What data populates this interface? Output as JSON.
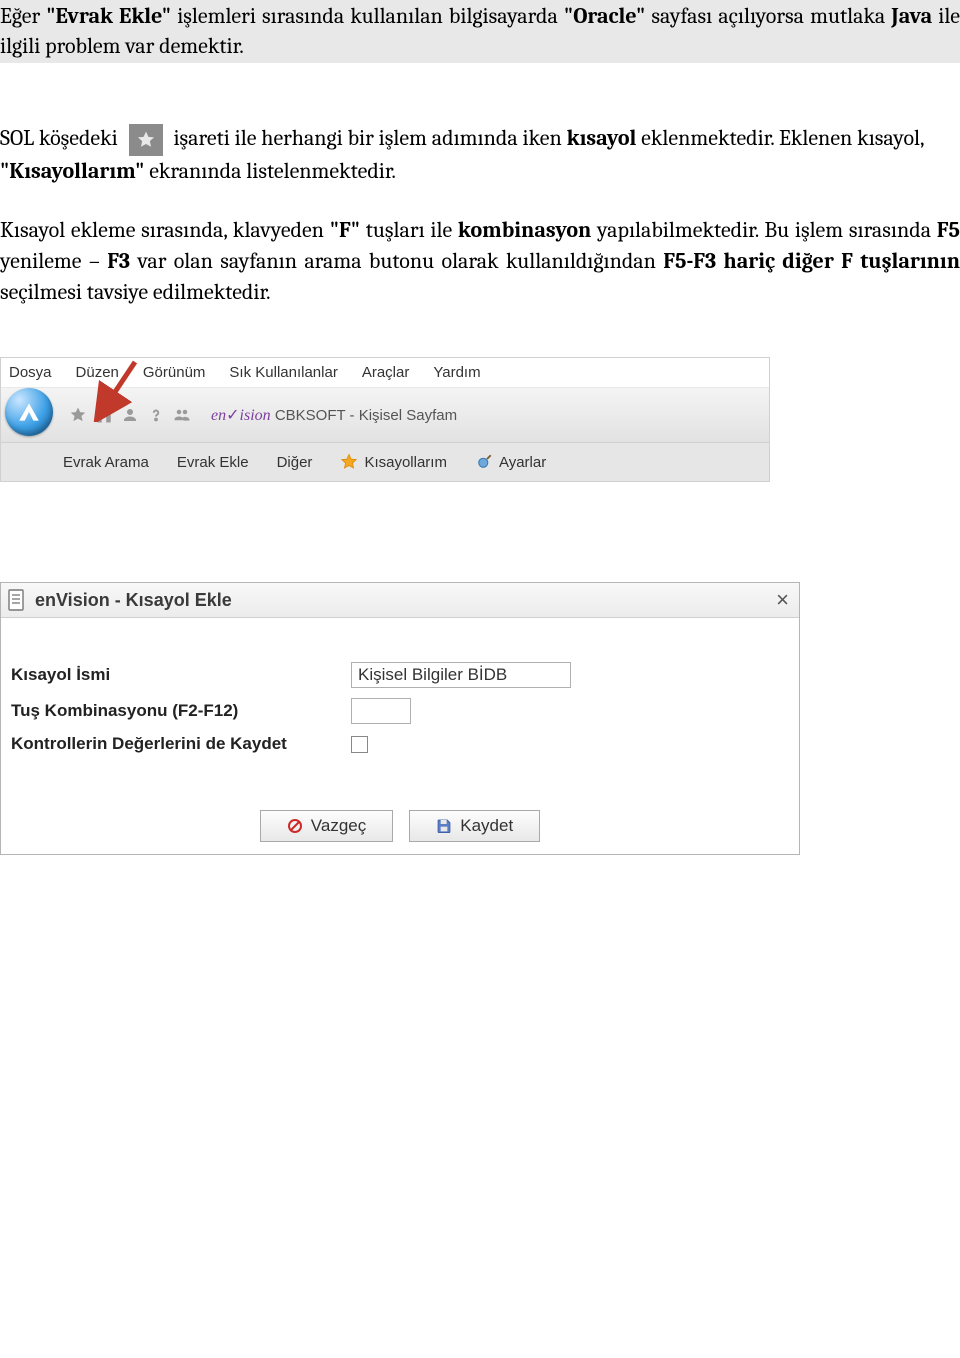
{
  "text": {
    "para1": "Eğer \"Evrak Ekle\" işlemleri sırasında kullanılan bilgisayarda \"Oracle\" sayfası açılıyorsa mutlaka Java ile ilgili problem var demektir.",
    "para1_lead": "Eğer",
    "para1_bold1": "\"Evrak Ekle\"",
    "para1_mid1": " işlemleri sırasında kullanılan bilgisayarda ",
    "para1_bold2": "\"Oracle\"",
    "para1_mid2": " sayfası açılıyorsa mutlaka ",
    "para1_bold3": "Java",
    "para1_tail": " ile ilgili problem var demektir.",
    "para2_lead": "SOL köşedeki",
    "para2_mid": " işareti ile herhangi bir işlem adımında iken ",
    "para2_bold1": "kısayol",
    "para2_mid2": " eklenmektedir. Eklenen kısayol, ",
    "para2_bold2": "\"Kısayollarım\"",
    "para2_tail": " ekranında listelenmektedir.",
    "para3_lead": "Kısayol ekleme sırasında, klavyeden ",
    "para3_bold1": "\"F\"",
    "para3_mid1": " tuşları ile ",
    "para3_bold2": "kombinasyon",
    "para3_mid2": " yapılabilmektedir. Bu işlem sırasında ",
    "para3_bold3": "F5",
    "para3_mid3": " yenileme – ",
    "para3_bold4": "F3",
    "para3_mid4": " var olan sayfanın arama butonu olarak kullanıldığından ",
    "para3_bold5": "F5-F3 hariç diğer F tuşlarının",
    "para3_tail": " seçilmesi tavsiye edilmektedir."
  },
  "menubar": {
    "items": [
      "Dosya",
      "Düzen",
      "Görünüm",
      "Sık Kullanılanlar",
      "Araçlar",
      "Yardım"
    ]
  },
  "header": {
    "brand_prefix": "en",
    "brand_suffix": "ision",
    "title_rest": "CBKSOFT - Kişisel Sayfam"
  },
  "toolbar": {
    "items": [
      "Evrak Arama",
      "Evrak Ekle",
      "Diğer",
      "Kısayollarım",
      "Ayarlar"
    ]
  },
  "dialog": {
    "title": "enVision - Kısayol Ekle",
    "fields": {
      "name_label": "Kısayol İsmi",
      "name_value": "Kişisel Bilgiler BİDB",
      "combo_label": "Tuş Kombinasyonu (F2-F12)",
      "combo_value": "",
      "save_vals_label": "Kontrollerin Değerlerini de Kaydet"
    },
    "buttons": {
      "cancel": "Vazgeç",
      "save": "Kaydet"
    }
  }
}
